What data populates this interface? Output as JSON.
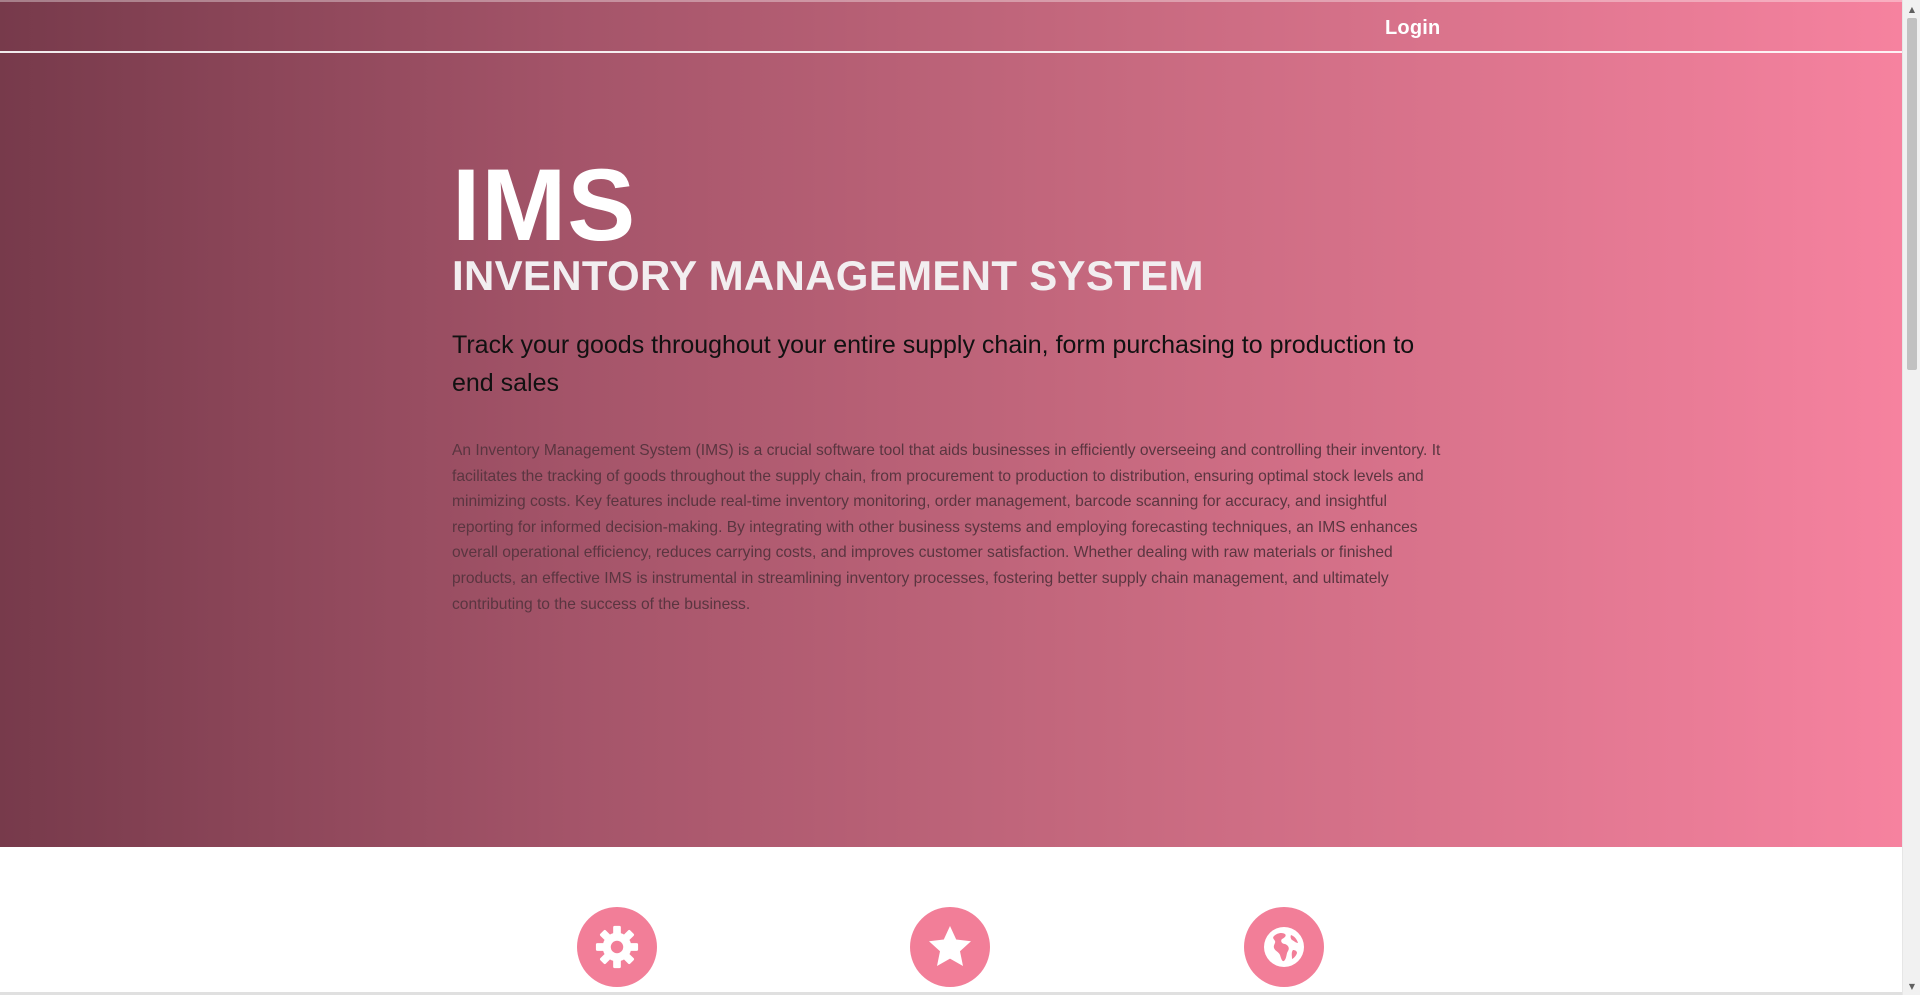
{
  "nav": {
    "login_label": "Login"
  },
  "hero": {
    "title": "IMS",
    "subtitle": "INVENTORY MANAGEMENT SYSTEM",
    "tagline": "Track your goods throughout your entire supply chain, form purchasing to production to end sales",
    "description": "An Inventory Management System (IMS) is a crucial software tool that aids businesses in efficiently overseeing and controlling their inventory. It facilitates the tracking of goods throughout the supply chain, from procurement to production to distribution, ensuring optimal stock levels and minimizing costs. Key features include real-time inventory monitoring, order management, barcode scanning for accuracy, and insightful reporting for informed decision-making. By integrating with other business systems and employing forecasting techniques, an IMS enhances overall operational efficiency, reduces carrying costs, and improves customer satisfaction. Whether dealing with raw materials or finished products, an effective IMS is instrumental in streamlining inventory processes, fostering better supply chain management, and ultimately contributing to the success of the business."
  },
  "features": {
    "icons": [
      "gear-icon",
      "star-icon",
      "globe-icon"
    ]
  },
  "colors": {
    "gradient_start": "#773a4b",
    "gradient_end": "#f6829f",
    "icon_circle": "#f27e98"
  }
}
